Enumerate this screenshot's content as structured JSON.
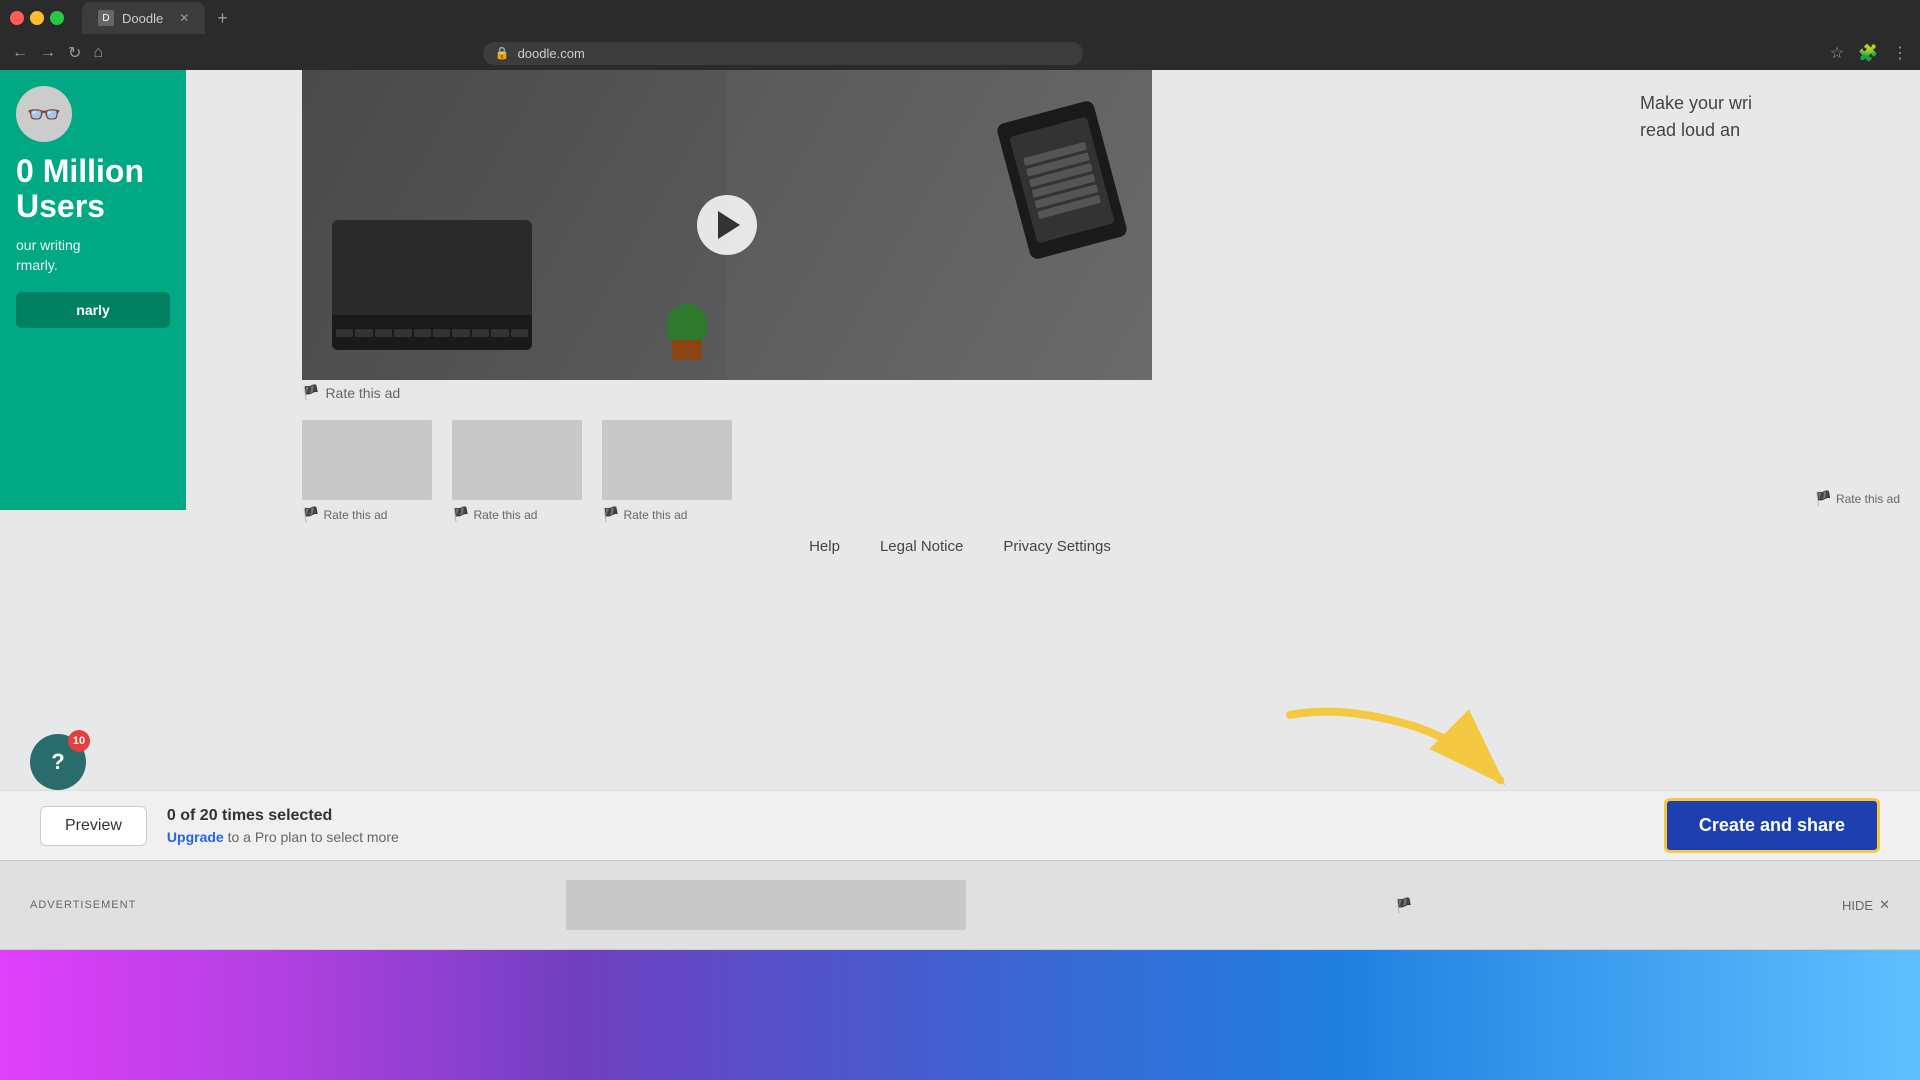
{
  "browser": {
    "tab_title": "Doodle",
    "url": "doodle.com",
    "tab_favicon": "D",
    "new_tab_icon": "+",
    "nav": {
      "back": "←",
      "forward": "→",
      "refresh": "↻",
      "home": "⌂"
    },
    "toolbar": {
      "star": "☆",
      "extensions": "🧩",
      "menu": "⋮"
    }
  },
  "left_panel": {
    "heading": "0 Million\nUsers",
    "subtext": "our writing\nrmarly.",
    "btn_label": "narly",
    "avatar_icon": "👓"
  },
  "right_panel": {
    "text": "Make your wri\nread loud an"
  },
  "video": {
    "play_label": "Play"
  },
  "rate_ad": {
    "main_label": "Rate this ad",
    "small1_label": "Rate this ad",
    "small2_label": "Rate this ad",
    "small3_label": "Rate this ad",
    "far_right_label": "Rate this ad"
  },
  "footer": {
    "links": [
      "Help",
      "Legal Notice",
      "Privacy Settings"
    ]
  },
  "toolbar": {
    "preview_label": "Preview",
    "selection_count": "0 of 20 times selected",
    "upgrade_text": "to a Pro plan to select more",
    "upgrade_link_label": "Upgrade",
    "create_share_label": "Create and share"
  },
  "ad_bar": {
    "label": "ADVERTISEMENT",
    "hide_label": "HIDE",
    "close_icon": "✕"
  },
  "help": {
    "icon": "?",
    "notification_count": "10"
  },
  "colors": {
    "green": "#00a884",
    "blue_btn": "#1e40af",
    "upgrade_blue": "#2563eb",
    "yellow_border": "#f5c842"
  }
}
